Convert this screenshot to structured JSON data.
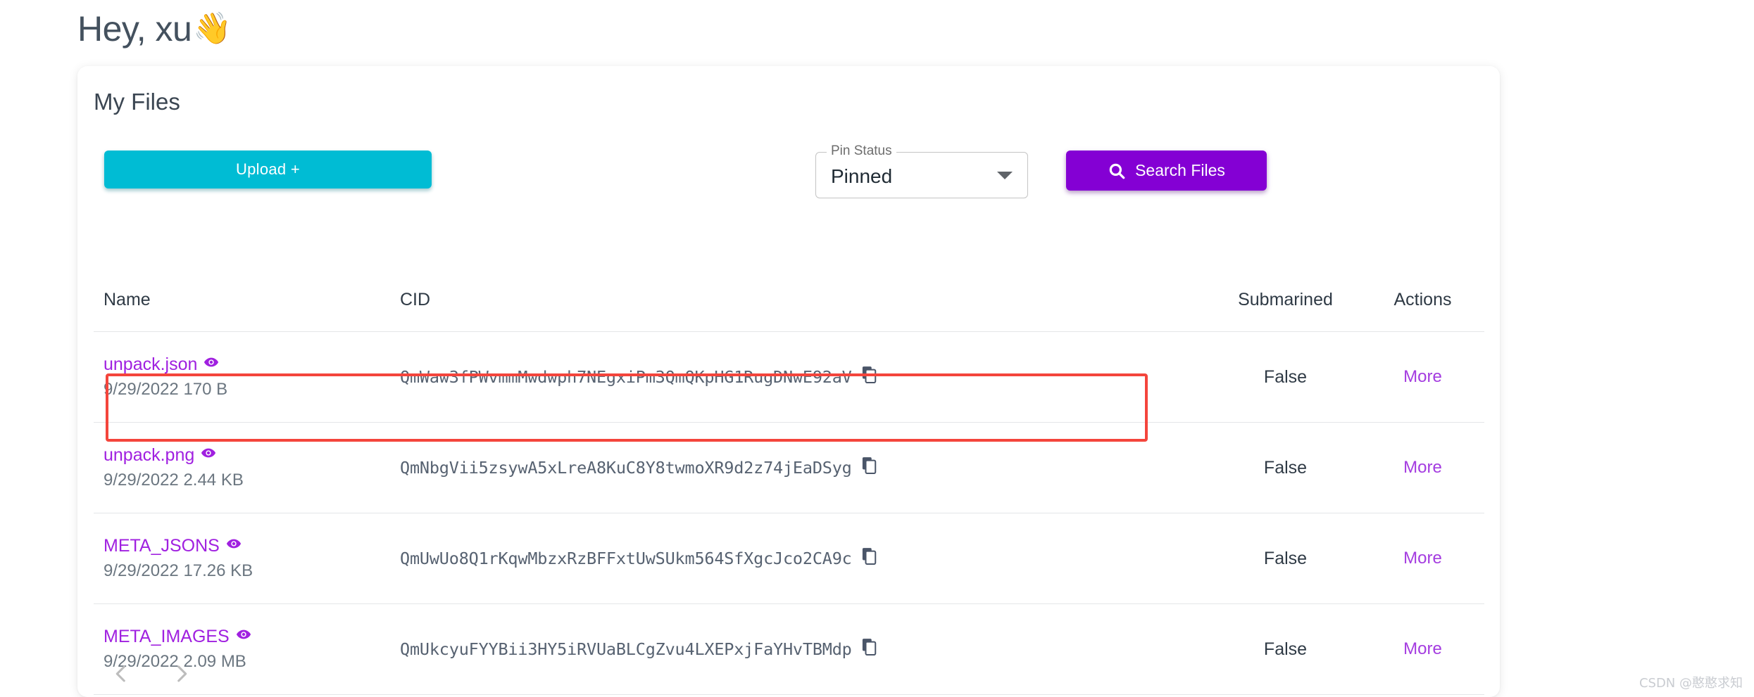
{
  "greeting": {
    "text": "Hey, xu",
    "emoji": "👋"
  },
  "card": {
    "title": "My Files"
  },
  "toolbar": {
    "upload_label": "Upload +",
    "pin_status_label": "Pin Status",
    "pin_status_value": "Pinned",
    "search_label": "Search Files"
  },
  "table": {
    "headers": {
      "name": "Name",
      "cid": "CID",
      "submarined": "Submarined",
      "actions": "Actions"
    },
    "rows": [
      {
        "name": "unpack.json",
        "meta": "9/29/2022 170 B",
        "cid": "QmWaw3fPWvmmMwdwph7NEgxiPm3QmQKpHG1RugDNwE92aV",
        "submarined": "False",
        "action": "More"
      },
      {
        "name": "unpack.png",
        "meta": "9/29/2022 2.44 KB",
        "cid": "QmNbgVii5zsywA5xLreA8KuC8Y8twmoXR9d2z74jEaDSyg",
        "submarined": "False",
        "action": "More"
      },
      {
        "name": "META_JSONS",
        "meta": "9/29/2022 17.26 KB",
        "cid": "QmUwUo8Q1rKqwMbzxRzBFFxtUwSUkm564SfXgcJco2CA9c",
        "submarined": "False",
        "action": "More"
      },
      {
        "name": "META_IMAGES",
        "meta": "9/29/2022 2.09 MB",
        "cid": "QmUkcyuFYYBii3HY5iRVUaBLCgZvu4LXEPxjFaYHvTBMdp",
        "submarined": "False",
        "action": "More"
      }
    ]
  },
  "watermark": {
    "text": "CSDN @憨憨求知"
  },
  "colors": {
    "upload_cyan": "#00bcd4",
    "search_purple": "#8400d4",
    "link_purple": "#a020e0",
    "highlight_red": "#f4453c"
  }
}
